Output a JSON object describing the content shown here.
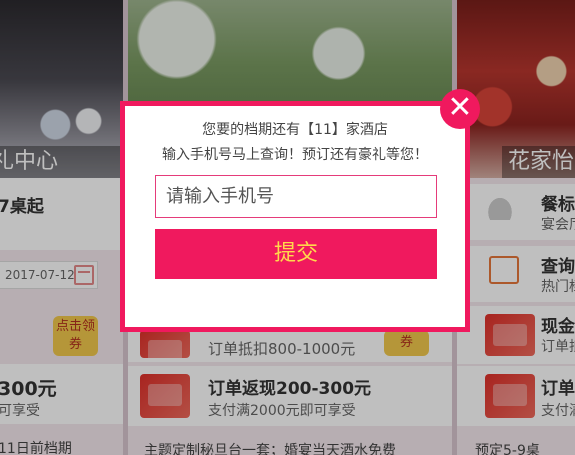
{
  "background": {
    "left": {
      "photo_title": "礼中心",
      "offer_top": "7桌起",
      "date": "2017-07-12",
      "offer_amount": "300元",
      "offer_sub": "可享受",
      "bottom": "11日前档期"
    },
    "middle": {
      "coupon_label": "点击领券",
      "coupon2_label": "券",
      "discount_text": "订单抵扣800-1000元",
      "cashback_title": "订单返现200-300元",
      "cashback_sub": "支付满2000元即可享受",
      "bottom_text": "主题定制秘旦台一套；婚宴当天酒水免费"
    },
    "right": {
      "photo_title": "花家怡",
      "item1_title": "餐标",
      "item1_sub": "宴会厅",
      "item2_title": "查询",
      "item2_sub": "热门档",
      "item3_title": "现金",
      "item3_sub": "订单抵",
      "item4_title": "订单",
      "item4_sub": "支付满",
      "bottom": "预定5-9桌"
    }
  },
  "modal": {
    "line1": "您要的档期还有【11】家酒店",
    "line2": "输入手机号马上查询！预订还有豪礼等您！",
    "phone_placeholder": "请输入手机号",
    "submit_label": "提交",
    "close_symbol": "✕"
  },
  "colors": {
    "accent": "#f0195e",
    "submit_text": "#ffd84c"
  },
  "icons": [
    "calendar-icon",
    "close-icon",
    "dish-icon",
    "heart-calendar-icon",
    "red-packet-icon"
  ]
}
